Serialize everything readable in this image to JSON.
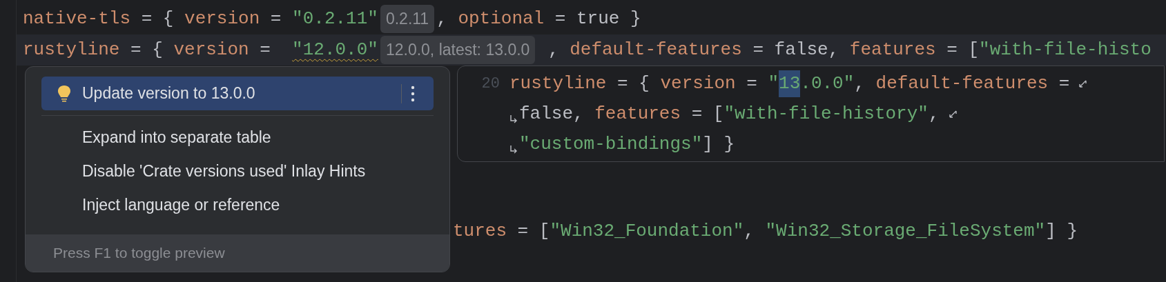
{
  "editor": {
    "lines": [
      {
        "current": false,
        "tokens": [
          {
            "kind": "key",
            "text": "native-tls"
          },
          {
            "kind": "op",
            "text": " = { "
          },
          {
            "kind": "key",
            "text": "version"
          },
          {
            "kind": "op",
            "text": " = "
          },
          {
            "kind": "str",
            "text": "\"0.2.11\""
          },
          {
            "kind": "hint",
            "text": "0.2.11"
          },
          {
            "kind": "op",
            "text": ", "
          },
          {
            "kind": "key",
            "text": "optional"
          },
          {
            "kind": "op",
            "text": " = true }"
          }
        ]
      },
      {
        "current": true,
        "tokens": [
          {
            "kind": "key",
            "text": "rustyline"
          },
          {
            "kind": "op",
            "text": " = { "
          },
          {
            "kind": "key",
            "text": "version"
          },
          {
            "kind": "op",
            "text": " =  "
          },
          {
            "kind": "str",
            "text": "\"12.0.0\"",
            "squiggly": true
          },
          {
            "kind": "hint",
            "text": "12.0.0, latest: 13.0.0"
          },
          {
            "kind": "op",
            "text": " , "
          },
          {
            "kind": "key",
            "text": "default-features"
          },
          {
            "kind": "op",
            "text": " = false, "
          },
          {
            "kind": "key",
            "text": "features"
          },
          {
            "kind": "op",
            "text": " = ["
          },
          {
            "kind": "str",
            "text": "\"with-file-histo"
          }
        ]
      },
      {
        "current": false,
        "tokens": [
          {
            "kind": "key",
            "text": "tures"
          },
          {
            "kind": "op",
            "text": " = ["
          },
          {
            "kind": "str",
            "text": "\"Win32_Foundation\""
          },
          {
            "kind": "op",
            "text": ", "
          },
          {
            "kind": "str",
            "text": "\"Win32_Storage_FileSystem\""
          },
          {
            "kind": "op",
            "text": "] }"
          }
        ]
      }
    ]
  },
  "intention_popup": {
    "actions": [
      {
        "label": "Update version to 13.0.0",
        "selected": true,
        "kind": "primary"
      },
      {
        "label": "Expand into separate table",
        "selected": false,
        "kind": "plain"
      },
      {
        "label": "Disable 'Crate versions used' Inlay Hints",
        "selected": false,
        "kind": "plain"
      },
      {
        "label": "Inject language or reference",
        "selected": false,
        "kind": "plain"
      }
    ],
    "footer": "Press F1 to toggle preview"
  },
  "preview": {
    "line_number": "20",
    "lines": [
      {
        "wrap_start": false,
        "wrap_end": true,
        "tokens": [
          {
            "kind": "key",
            "text": "rustyline"
          },
          {
            "kind": "op",
            "text": " = { "
          },
          {
            "kind": "key",
            "text": "version"
          },
          {
            "kind": "op",
            "text": " = "
          },
          {
            "kind": "str",
            "text": "\""
          },
          {
            "kind": "str",
            "text": "13",
            "highlighted": true
          },
          {
            "kind": "str",
            "text": ".0.0\""
          },
          {
            "kind": "op",
            "text": ", "
          },
          {
            "kind": "key",
            "text": "default-features"
          },
          {
            "kind": "op",
            "text": " ="
          }
        ]
      },
      {
        "wrap_start": true,
        "wrap_end": true,
        "tokens": [
          {
            "kind": "op",
            "text": "false, "
          },
          {
            "kind": "key",
            "text": "features"
          },
          {
            "kind": "op",
            "text": " = ["
          },
          {
            "kind": "str",
            "text": "\"with-file-history\""
          },
          {
            "kind": "op",
            "text": ","
          }
        ]
      },
      {
        "wrap_start": true,
        "wrap_end": false,
        "tokens": [
          {
            "kind": "str",
            "text": "\"custom-bindings\""
          },
          {
            "kind": "op",
            "text": "] }"
          }
        ]
      }
    ]
  }
}
